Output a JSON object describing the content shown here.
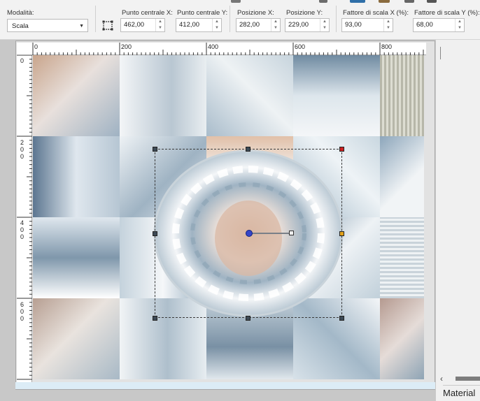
{
  "toolbar": {
    "mode_label": "Modalità:",
    "mode_value": "Scala",
    "center_x_label": "Punto centrale X:",
    "center_x_value": "462,00",
    "center_y_label": "Punto centrale Y:",
    "center_y_value": "412,00",
    "pos_x_label": "Posizione X:",
    "pos_x_value": "282,00",
    "pos_y_label": "Posizione Y:",
    "pos_y_value": "229,00",
    "scale_x_label": "Fattore di scala X (%):",
    "scale_x_value": "93,00",
    "scale_y_label": "Fattore di scala Y (%):",
    "scale_y_value": "68,00"
  },
  "rulers": {
    "horizontal": [
      "0",
      "200",
      "400",
      "600",
      "800"
    ],
    "vertical": [
      [
        "0"
      ],
      [
        "2",
        "0",
        "0"
      ],
      [
        "4",
        "0",
        "0"
      ],
      [
        "6",
        "0",
        "0"
      ]
    ]
  },
  "right_panel": {
    "tab_label": "Material",
    "scroll_left_icon": "chevron-left-icon"
  },
  "icons": {
    "transform_tool": "transform-box-icon",
    "spin_arrows": "spinner-icon",
    "dropdown_arrow": "chevron-down-icon"
  },
  "colors": {
    "selection_border": "#3a3a3a",
    "pivot": "#3545c8",
    "workspace_bg": "#c8c8c8",
    "doc_accent": "#dcecf6"
  }
}
